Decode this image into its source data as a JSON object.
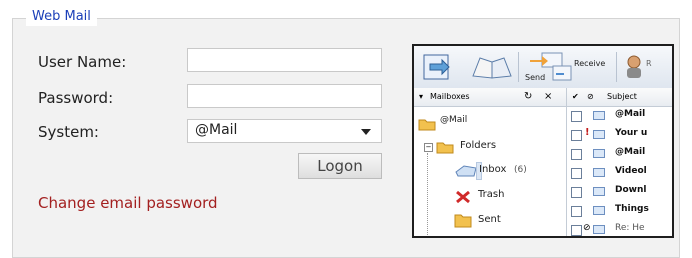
{
  "panel": {
    "legend": "Web Mail"
  },
  "form": {
    "username_label": "User Name:",
    "password_label": "Password:",
    "system_label": "System:",
    "username_value": "",
    "password_value": "",
    "system_selected": "@Mail",
    "logon_label": "Logon",
    "change_password_link": "Change email password"
  },
  "preview": {
    "toolbar": {
      "send_label": "Send",
      "receive_label": "Receive",
      "truncated_label": "R"
    },
    "mailboxes_header": "Mailboxes",
    "list_header": {
      "subject_label": "Subject"
    },
    "tree": {
      "account": "@Mail",
      "folders": "Folders",
      "inbox": "Inbox",
      "inbox_count": "(6)",
      "trash": "Trash",
      "sent": "Sent"
    },
    "messages": [
      {
        "subject": "@Mail"
      },
      {
        "subject": "Your u",
        "flag": "!"
      },
      {
        "subject": "@Mail"
      },
      {
        "subject": "Videol"
      },
      {
        "subject": "Downl"
      },
      {
        "subject": "Things"
      },
      {
        "subject": "Re: He"
      }
    ]
  },
  "colors": {
    "legend": "#1b3fb8",
    "link": "#a32020"
  }
}
